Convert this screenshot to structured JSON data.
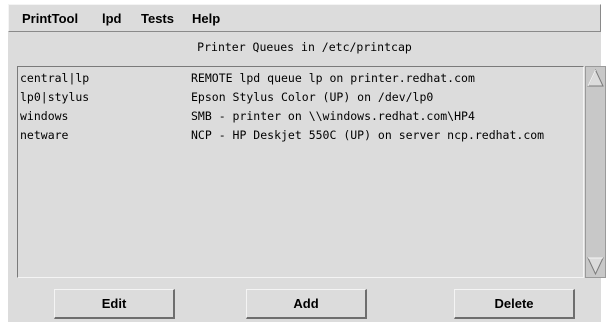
{
  "menubar": {
    "items": [
      {
        "label": "PrintTool"
      },
      {
        "label": "lpd"
      },
      {
        "label": "Tests"
      },
      {
        "label": "Help"
      }
    ]
  },
  "queues": {
    "title": "Printer Queues in /etc/printcap",
    "rows": [
      {
        "name": "central|lp",
        "description": "REMOTE lpd queue lp on printer.redhat.com"
      },
      {
        "name": "lp0|stylus",
        "description": "Epson Stylus Color (UP) on /dev/lp0"
      },
      {
        "name": "windows",
        "description": "SMB - printer on \\\\windows.redhat.com\\HP4"
      },
      {
        "name": "netware",
        "description": "NCP - HP Deskjet 550C (UP) on server ncp.redhat.com"
      }
    ]
  },
  "buttons": {
    "edit": "Edit",
    "add": "Add",
    "delete": "Delete"
  },
  "scrollbar": {
    "up_icon": "up-arrow-icon",
    "down_icon": "down-arrow-icon"
  }
}
